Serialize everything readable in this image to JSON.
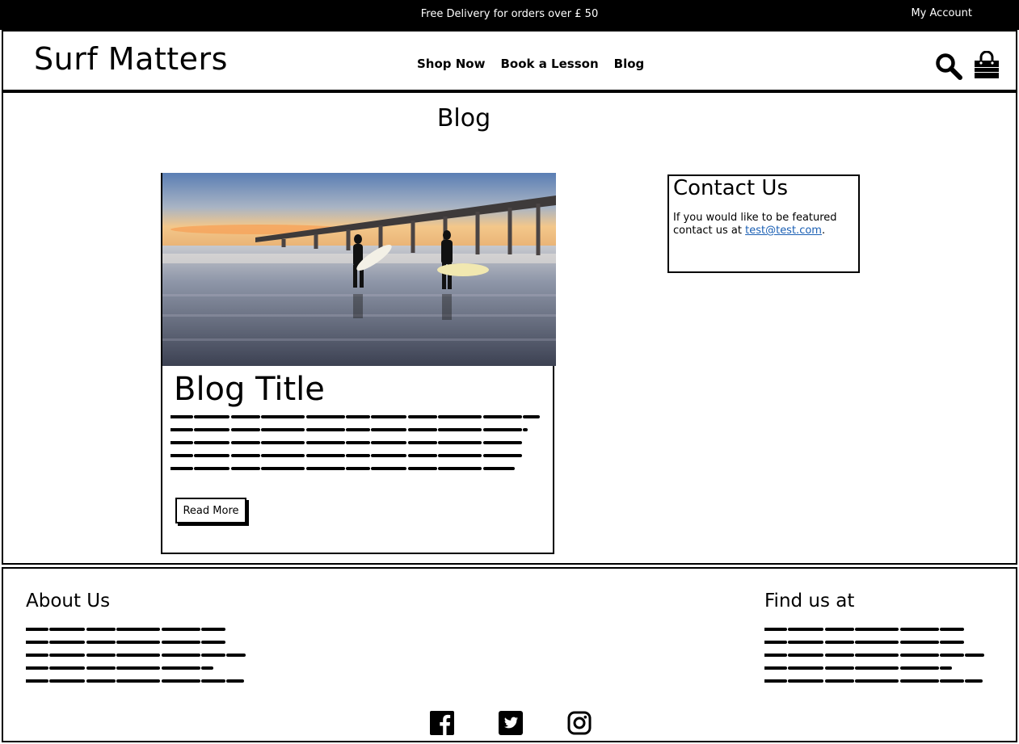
{
  "topbar": {
    "promo": "Free Delivery for orders over £ 50",
    "account": "My Account"
  },
  "header": {
    "logo": "Surf Matters",
    "nav": [
      "Shop Now",
      "Book a Lesson",
      "Blog"
    ],
    "icons": {
      "search": "search-icon",
      "bag": "shopping-bag-icon"
    }
  },
  "main": {
    "title": "Blog",
    "post": {
      "title": "Blog Title",
      "button": "Read More"
    },
    "contact": {
      "heading": "Contact Us",
      "text": "If you would like to be featured contact us at",
      "email": "test@test.com",
      "after": "."
    }
  },
  "footer": {
    "about_heading": "About Us",
    "find_heading": "Find us at",
    "social": [
      "facebook-icon",
      "twitter-icon",
      "instagram-icon"
    ]
  },
  "colors": {
    "topbar_bg": "#000000",
    "link": "#1a5fb4"
  }
}
